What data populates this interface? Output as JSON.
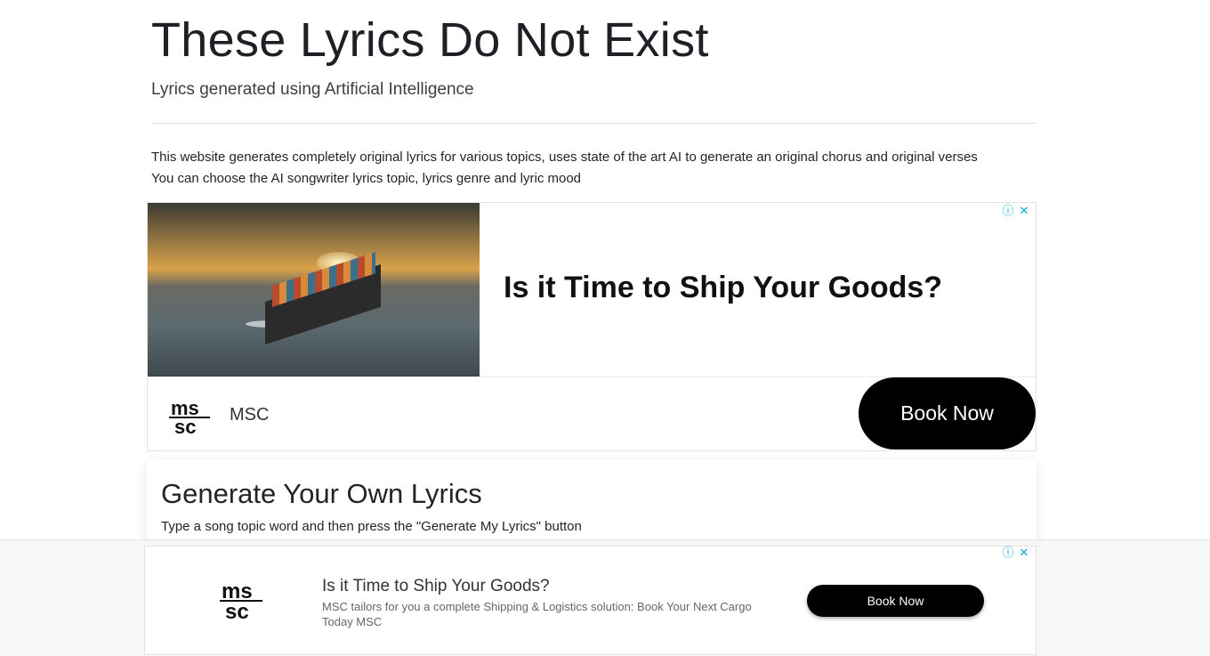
{
  "header": {
    "title": "These Lyrics Do Not Exist",
    "subtitle": "Lyrics generated using Artificial Intelligence"
  },
  "intro": {
    "line1": "This website generates completely original lyrics for various topics, uses state of the art AI to generate an original chorus and original verses",
    "line2": "You can choose the AI songwriter lyrics topic, lyrics genre and lyric mood"
  },
  "ad_top": {
    "headline": "Is it Time to Ship Your Goods?",
    "brand": "MSC",
    "cta": "Book Now",
    "info_icon": "info-icon",
    "close_icon": "close-icon"
  },
  "generate_card": {
    "title": "Generate Your Own Lyrics",
    "instructions": "Type a song topic word and then press the \"Generate My Lyrics\" button"
  },
  "ad_bottom": {
    "headline": "Is it Time to Ship Your Goods?",
    "description": "MSC tailors for you a complete Shipping & Logistics solution: Book Your Next Cargo Today MSC",
    "cta": "Book Now",
    "info_icon": "info-icon",
    "close_icon": "close-icon"
  },
  "colors": {
    "text": "#212529",
    "button_bg": "#000000",
    "adchoices": "#00aecd"
  }
}
